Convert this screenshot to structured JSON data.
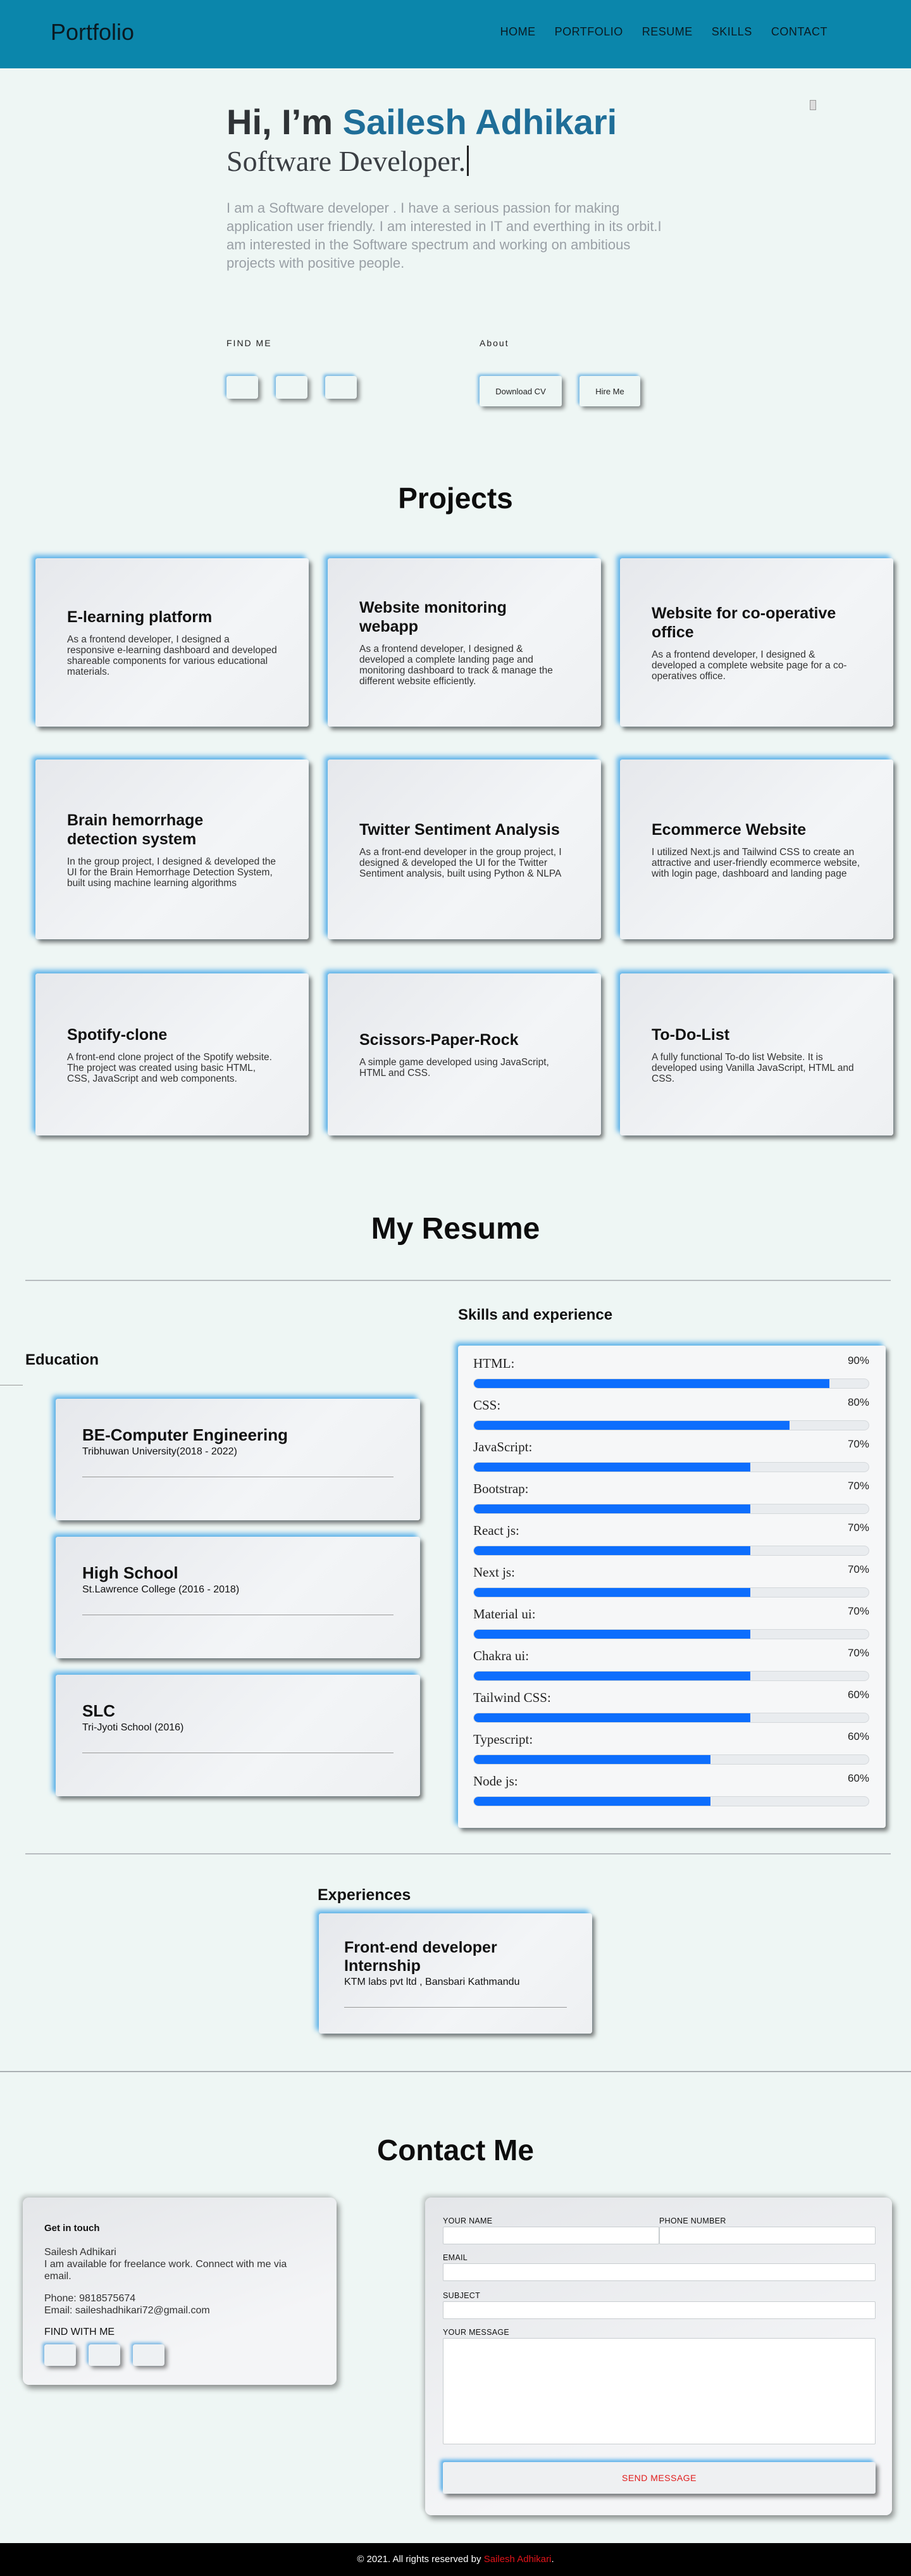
{
  "nav": {
    "brand": "Portfolio",
    "links": [
      "HOME",
      "PORTFOLIO",
      "RESUME",
      "SKILLS",
      "CONTACT"
    ]
  },
  "hero": {
    "greeting": "Hi, I’m ",
    "name": "Sailesh Adhikari",
    "role": "Software Developer.",
    "description": "I am a Software developer . I have a serious passion for making application user friendly. I am interested in IT and everthing in its orbit.I am interested in the Software spectrum and working on ambitious projects with positive people.",
    "find_me_label": "FIND ME",
    "about_label": "About",
    "download_cv": "Download CV",
    "hire_me": "Hire Me"
  },
  "projects": {
    "heading": "Projects",
    "items": [
      {
        "title": "E-learning platform",
        "desc": "As a frontend developer, I designed a responsive e-learning dashboard and developed shareable components for various educational materials."
      },
      {
        "title": "Website monitoring webapp",
        "desc": "As a frontend developer, I designed & developed a complete landing page and monitoring dashboard to track & manage the different website efficiently."
      },
      {
        "title": "Website for co-operative office",
        "desc": "As a frontend developer, I designed & developed a complete website page for a co-operatives office."
      },
      {
        "title": "Brain hemorrhage detection system",
        "desc": "In the group project, I designed & developed the UI for the Brain Hemorrhage Detection System, built using machine learning algorithms"
      },
      {
        "title": "Twitter Sentiment Analysis",
        "desc": "As a front-end developer in the group project, I designed & developed the UI for the Twitter Sentiment analysis, built using Python & NLPA"
      },
      {
        "title": "Ecommerce Website",
        "desc": "I utilized Next.js and Tailwind CSS to create an attractive and user-friendly ecommerce website, with login page, dashboard and landing page"
      },
      {
        "title": "Spotify-clone",
        "desc": "A front-end clone project of the Spotify website. The project was created using basic HTML, CSS, JavaScript and web components."
      },
      {
        "title": "Scissors-Paper-Rock",
        "desc": "A simple game developed using JavaScript, HTML and CSS."
      },
      {
        "title": "To-Do-List",
        "desc": "A fully functional To-do list Website. It is developed using Vanilla JavaScript, HTML and CSS."
      }
    ]
  },
  "resume": {
    "heading": "My Resume",
    "education_heading": "Education",
    "education": [
      {
        "title": "BE-Computer Engineering",
        "place": "Tribhuwan University(2018 - 2022)"
      },
      {
        "title": "High School",
        "place": "St.Lawrence College (2016 - 2018)"
      },
      {
        "title": "SLC",
        "place": "Tri-Jyoti School (2016)"
      }
    ],
    "skills_heading": "Skills and experience",
    "skills": [
      {
        "name": "HTML:",
        "pct_label": "90%",
        "value": 90
      },
      {
        "name": "CSS:",
        "pct_label": "80%",
        "value": 80
      },
      {
        "name": "JavaScript:",
        "pct_label": "70%",
        "value": 70
      },
      {
        "name": "Bootstrap:",
        "pct_label": "70%",
        "value": 70
      },
      {
        "name": "React js:",
        "pct_label": "70%",
        "value": 70
      },
      {
        "name": "Next js:",
        "pct_label": "70%",
        "value": 70
      },
      {
        "name": "Material ui:",
        "pct_label": "70%",
        "value": 70
      },
      {
        "name": "Chakra ui:",
        "pct_label": "70%",
        "value": 70
      },
      {
        "name": "Tailwind CSS:",
        "pct_label": "60%",
        "value": 70
      },
      {
        "name": "Typescript:",
        "pct_label": "60%",
        "value": 60
      },
      {
        "name": "Node js:",
        "pct_label": "60%",
        "value": 60
      }
    ],
    "experiences_heading": "Experiences",
    "experience": {
      "title": "Front-end developer Internship",
      "place": "KTM labs pvt ltd , Bansbari Kathmandu"
    }
  },
  "contact": {
    "heading": "Contact Me",
    "touch_heading": "Get in touch",
    "touch_name": "Sailesh Adhikari",
    "touch_text": "I am available for freelance work. Connect with me via email.",
    "phone": "Phone: 9818575674",
    "email": "Email: saileshadhikari72@gmail.com",
    "find_with_me": "FIND WITH ME",
    "form": {
      "name_label": "YOUR NAME",
      "phone_label": "PHONE NUMBER",
      "email_label": "EMAIL",
      "subject_label": "SUBJECT",
      "message_label": "YOUR MESSAGE",
      "send_label": "SEND MESSAGE"
    }
  },
  "footer": {
    "text": "© 2021. All rights reserved by ",
    "author": "Sailesh Adhikari",
    "end": "."
  },
  "colors": {
    "nav_bg": "#0b86ab",
    "page_bg": "#eef6f4",
    "name_accent": "#1f6e98",
    "progress": "#0d6efd",
    "send_text": "#e01b1b",
    "footer_author": "#e4141b"
  }
}
